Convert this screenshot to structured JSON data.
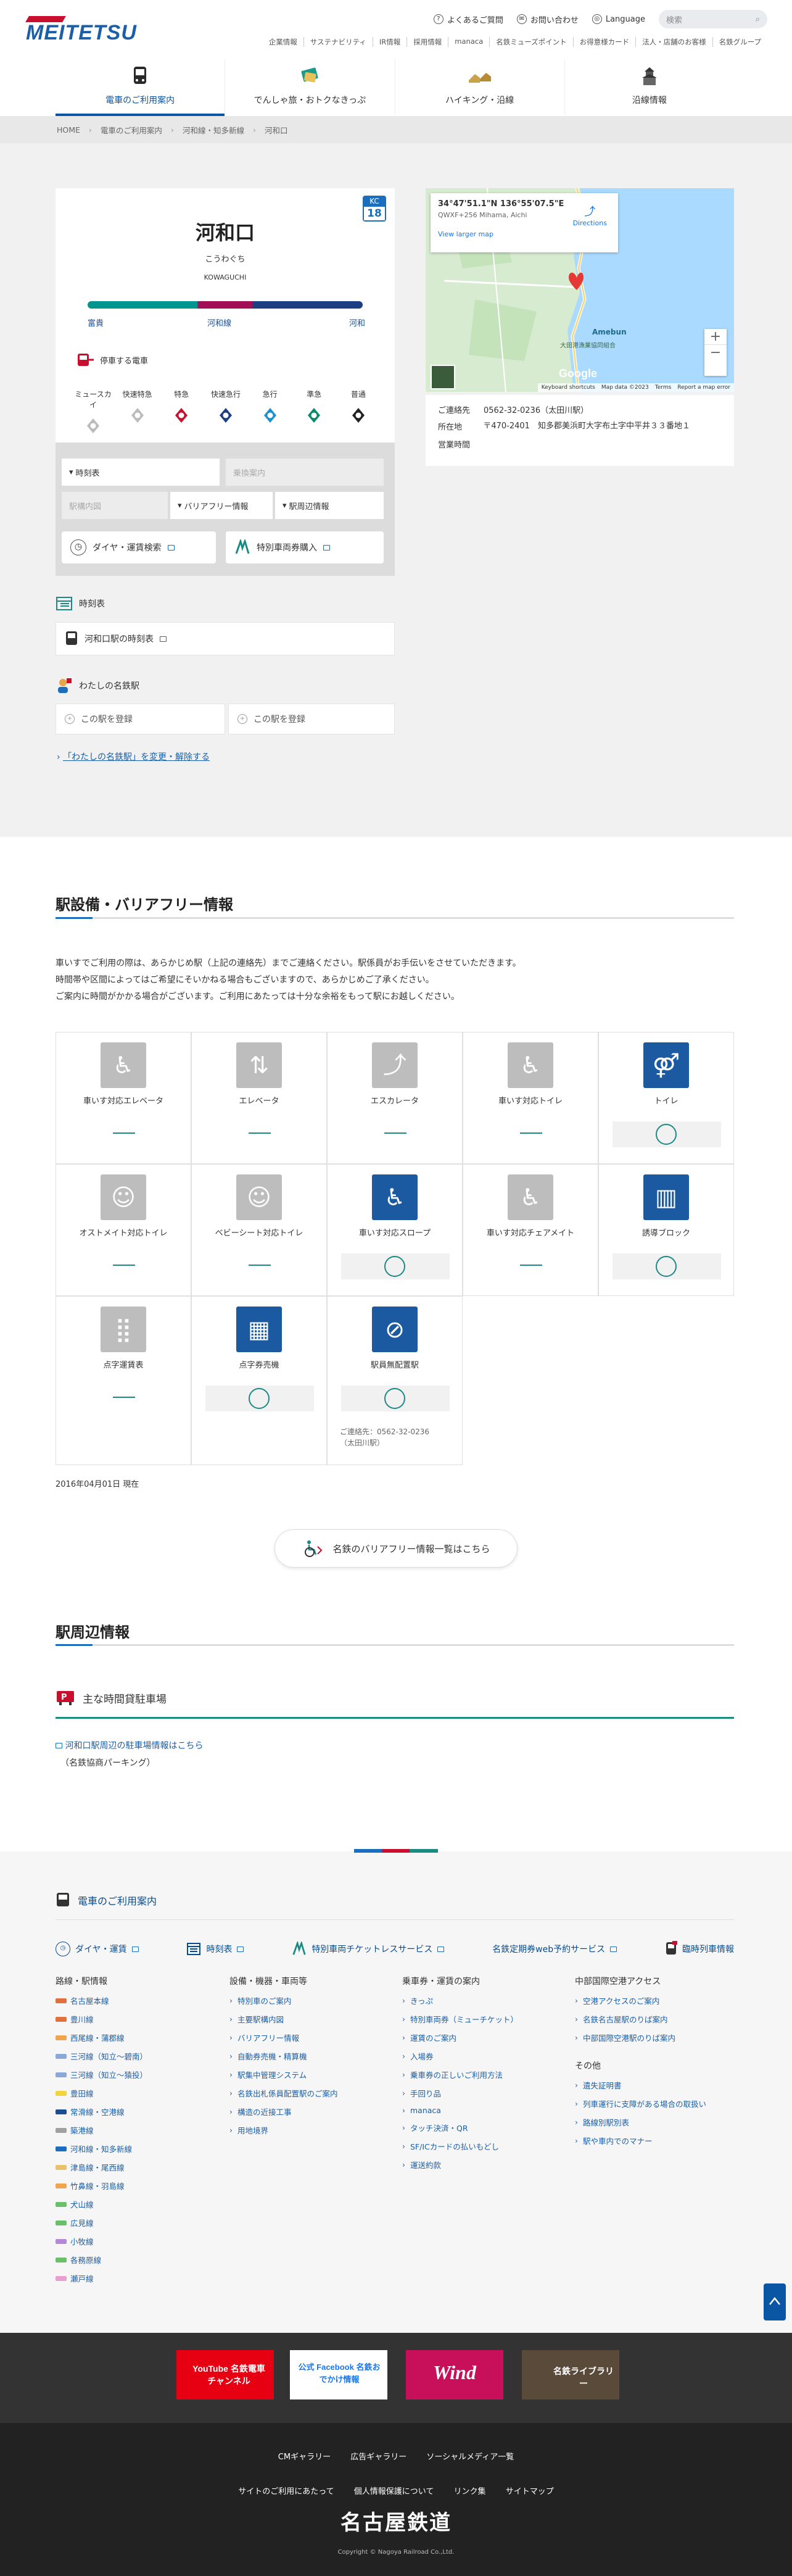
{
  "header": {
    "logo": "MEITETSU",
    "util": [
      "よくあるご質問",
      "お問い合わせ",
      "Language"
    ],
    "search_placeholder": "検索",
    "subnav": [
      "企業情報",
      "サステナビリティ",
      "IR情報",
      "採用情報",
      "manaca",
      "名鉄ミューズポイント",
      "お得意様カード",
      "法人・店舗のお客様",
      "名鉄グループ"
    ],
    "mainnav": [
      "電車のご利用案内",
      "でんしゃ旅・おトクなきっぷ",
      "ハイキング・沿線",
      "沿線情報"
    ]
  },
  "breadcrumb": [
    "HOME",
    "電車のご利用案内",
    "河和線・知多新線",
    "河和口"
  ],
  "station": {
    "name": "河和口",
    "kana": "こうわぐち",
    "roman": "KOWAGUCHI",
    "code_prefix": "KC",
    "code_number": "18",
    "line_left": "富貴",
    "line_center": "河和線",
    "line_right": "河和",
    "stop_label": "停車する電車",
    "trains": [
      {
        "name": "ミュースカイ",
        "color": "#bbbbbb"
      },
      {
        "name": "快速特急",
        "color": "#bbbbbb"
      },
      {
        "name": "特急",
        "color": "#c8102e"
      },
      {
        "name": "快速急行",
        "color": "#1e3e84"
      },
      {
        "name": "急行",
        "color": "#1b8fd0"
      },
      {
        "name": "準急",
        "color": "#0a8a6a"
      },
      {
        "name": "普通",
        "color": "#222222"
      }
    ]
  },
  "panel": {
    "tab_timetable": "時刻表",
    "tab_route": "乗換案内",
    "tab_map": "駅構内図",
    "tab_barrier": "バリアフリー情報",
    "tab_around": "駅周辺情報",
    "btn_dia": "ダイヤ・運賃検索",
    "btn_ticket": "特別車両券購入"
  },
  "map": {
    "coord": "34°47'51.1\"N 136°55'07.5\"E",
    "plus": "QWXF+256 Mihama, Aichi",
    "directions": "Directions",
    "larger": "View larger map",
    "place": "Amebun",
    "place2": "大田港漁業協同組合",
    "footer": [
      "Keyboard shortcuts",
      "Map data ©2023",
      "Terms",
      "Report a map error"
    ],
    "google": "Google"
  },
  "info": {
    "contact_key": "ご連絡先",
    "contact_val": "0562-32-0236（太田川駅）",
    "addr_key": "所在地",
    "addr_val": "〒470-2401　知多郡美浜町大字布土字中平井３３番地１",
    "hours_key": "営業時間",
    "hours_val": ""
  },
  "timetable": {
    "label": "時刻表",
    "link": "河和口駅の時刻表"
  },
  "mystation": {
    "label": "わたしの名鉄駅",
    "reg1": "この駅を登録",
    "reg2": "この駅を登録",
    "change": "「わたしの名鉄駅」を変更・解除する"
  },
  "facilities": {
    "title": "駅設備・バリアフリー情報",
    "desc": [
      "車いすでご利用の際は、あらかじめ駅（上記の連絡先）までご連絡ください。駅係員がお手伝いをさせていただきます。",
      "時間帯や区間によってはご希望にそいかねる場合もございますので、あらかじめご了承ください。",
      "ご案内に時間がかかる場合がございます。ご利用にあたっては十分な余裕をもって駅にお越しください。"
    ],
    "items": [
      {
        "label": "車いす対応エレベータ",
        "available": false,
        "icon": "elevator-wheelchair-icon"
      },
      {
        "label": "エレベータ",
        "available": false,
        "icon": "elevator-icon"
      },
      {
        "label": "エスカレータ",
        "available": false,
        "icon": "escalator-icon"
      },
      {
        "label": "車いす対応トイレ",
        "available": false,
        "icon": "accessible-toilet-icon"
      },
      {
        "label": "トイレ",
        "available": true,
        "icon": "toilet-icon"
      },
      {
        "label": "オストメイト対応トイレ",
        "available": false,
        "icon": "ostomate-icon"
      },
      {
        "label": "ベビーシート対応トイレ",
        "available": false,
        "icon": "baby-seat-icon"
      },
      {
        "label": "車いす対応スロープ",
        "available": true,
        "icon": "slope-icon"
      },
      {
        "label": "車いす対応チェアメイト",
        "available": false,
        "icon": "chairmate-icon"
      },
      {
        "label": "誘導ブロック",
        "available": true,
        "icon": "guide-block-icon"
      },
      {
        "label": "点字運賃表",
        "available": false,
        "icon": "braille-fare-icon"
      },
      {
        "label": "点字券売機",
        "available": true,
        "icon": "braille-ticket-machine-icon"
      },
      {
        "label": "駅員無配置駅",
        "available": true,
        "icon": "no-staff-icon"
      }
    ],
    "contact_note_1": "ご連絡先：0562-32-0236",
    "contact_note_2": "（太田川駅）",
    "date": "2016年04月01日 現在",
    "barrier_link": "名鉄のバリアフリー情報一覧はこちら"
  },
  "around": {
    "title": "駅周辺情報",
    "parking_title": "主な時間貸駐車場",
    "parking_link": "河和口駅周辺の駐車場情報はこちら",
    "parking_note": "（名鉄協商パーキング）"
  },
  "footer": {
    "title": "電車のご利用案内",
    "row": [
      "ダイヤ・運賃",
      "時刻表",
      "特別車両チケットレスサービス",
      "名鉄定期券web予約サービス",
      "臨時列車情報"
    ],
    "col1_head": "路線・駅情報",
    "lines": [
      {
        "name": "名古屋本線",
        "color": "#e0703c"
      },
      {
        "name": "豊川線",
        "color": "#e0703c"
      },
      {
        "name": "西尾線・蒲郡線",
        "color": "#f0a64d"
      },
      {
        "name": "三河線（知立〜碧南）",
        "color": "#8aa8d8"
      },
      {
        "name": "三河線（知立〜猿投）",
        "color": "#8aa8d8"
      },
      {
        "name": "豊田線",
        "color": "#f4d23a"
      },
      {
        "name": "常滑線・空港線",
        "color": "#1e4d92"
      },
      {
        "name": "築港線",
        "color": "#a0a0a0"
      },
      {
        "name": "河和線・知多新線",
        "color": "#1b6dbd"
      },
      {
        "name": "津島線・尾西線",
        "color": "#e8c16a"
      },
      {
        "name": "竹鼻線・羽島線",
        "color": "#f0a64d"
      },
      {
        "name": "犬山線",
        "color": "#6ac06a"
      },
      {
        "name": "広見線",
        "color": "#6ac06a"
      },
      {
        "name": "小牧線",
        "color": "#b48ad8"
      },
      {
        "name": "各務原線",
        "color": "#6ac06a"
      },
      {
        "name": "瀬戸線",
        "color": "#e8a0d0"
      }
    ],
    "col2_head": "設備・機器・車両等",
    "col2": [
      "特別車のご案内",
      "主要駅構内図",
      "バリアフリー情報",
      "自動券売機・精算機",
      "駅集中管理システム",
      "名鉄出札係員配置駅のご案内",
      "構造の近接工事",
      "用地境界"
    ],
    "col3_head": "乗車券・運賃の案内",
    "col3": [
      "きっぷ",
      "特別車両券（ミューチケット）",
      "運賃のご案内",
      "入場券",
      "乗車券の正しいご利用方法",
      "手回り品",
      "manaca",
      "タッチ決済・QR",
      "SF/ICカードの払いもどし",
      "運送約款"
    ],
    "col4_head": "中部国際空港アクセス",
    "col4": [
      "空港アクセスのご案内",
      "名鉄名古屋駅のりば案内",
      "中部国際空港駅のりば案内"
    ],
    "col4b_head": "その他",
    "col4b": [
      "遺失証明書",
      "列車運行に支障がある場合の取扱い",
      "路線別駅別表",
      "駅や車内でのマナー"
    ]
  },
  "banners": [
    "YouTube 名鉄電車チャンネル",
    "公式 Facebook 名鉄おでかけ情報",
    "Wind",
    "名鉄ライブラリー"
  ],
  "bottom": {
    "row1": [
      "CMギャラリー",
      "広告ギャラリー",
      "ソーシャルメディア一覧"
    ],
    "row2": [
      "サイトのご利用にあたって",
      "個人情報保護について",
      "リンク集",
      "サイトマップ"
    ],
    "corp": "名古屋鉄道",
    "copy": "Copyright © Nagoya Railroad Co.,Ltd."
  }
}
